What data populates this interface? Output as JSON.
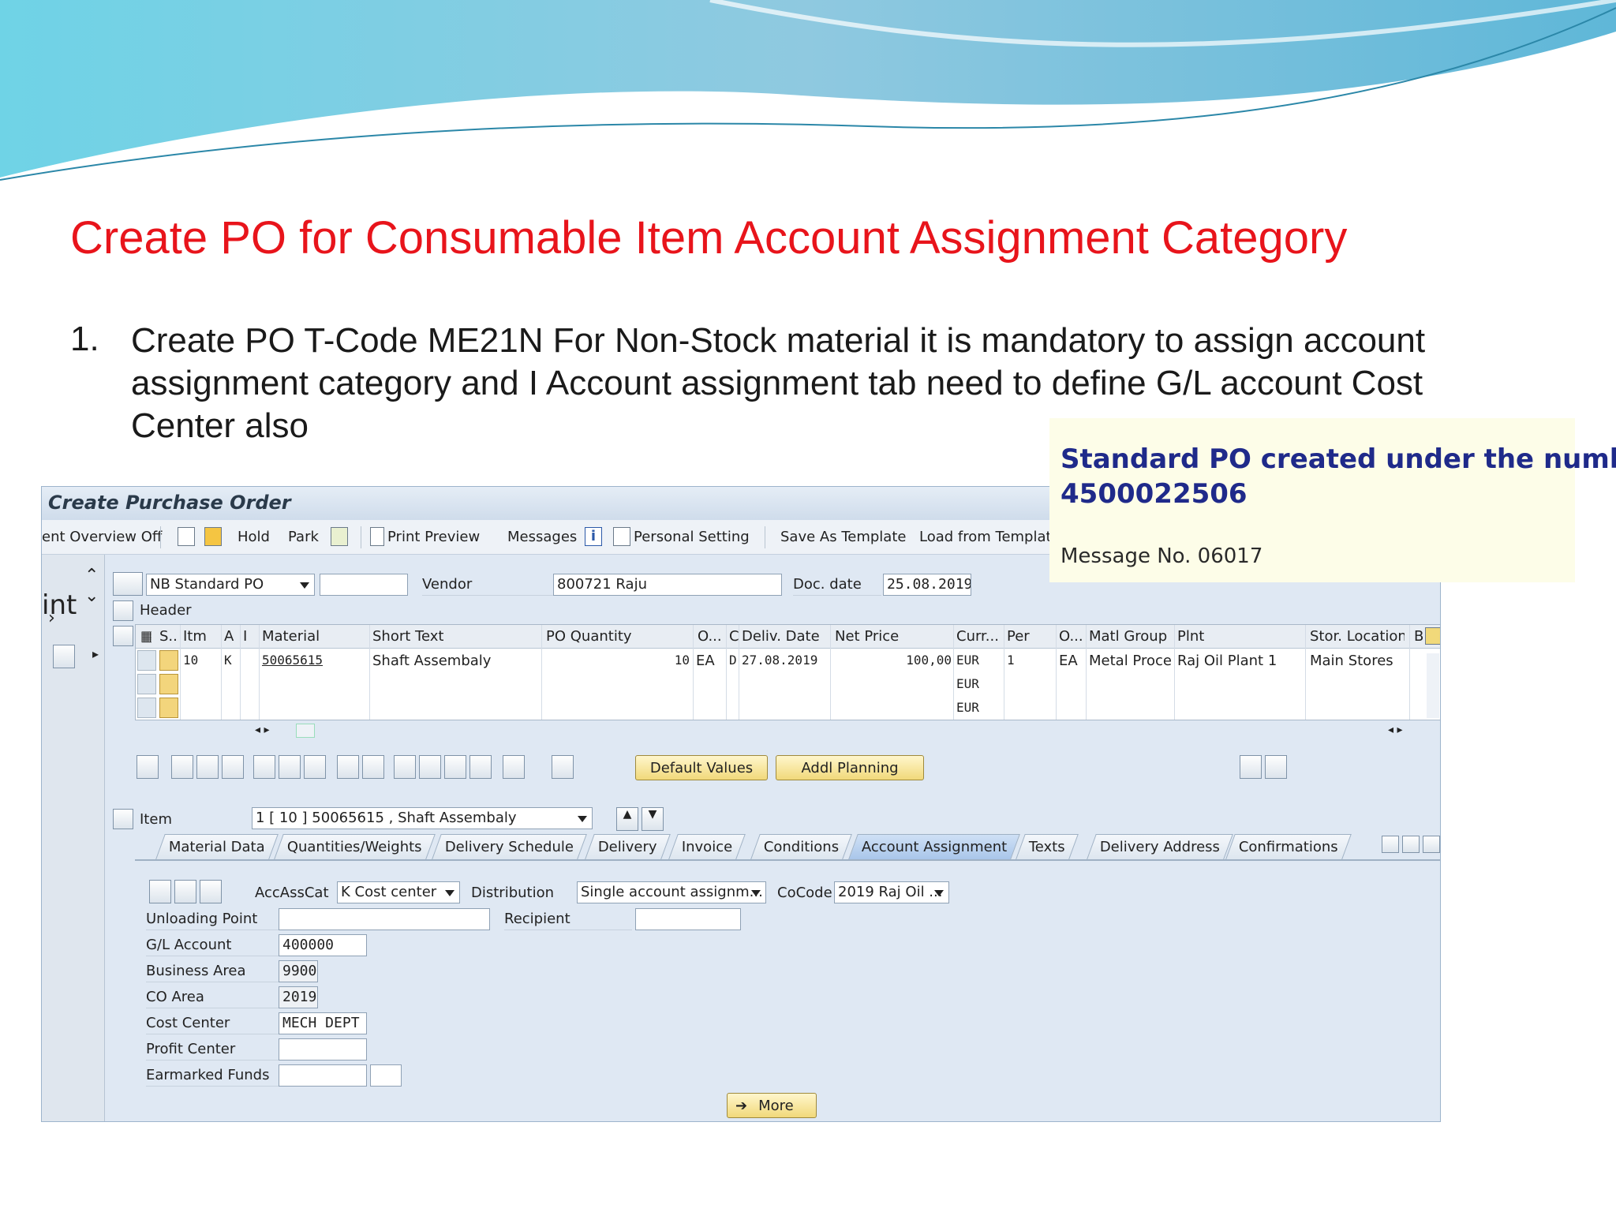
{
  "slide": {
    "title": "Create PO for Consumable Item Account Assignment Category",
    "bullet_number": "1.",
    "bullet_text": "Create PO T-Code ME21N For Non-Stock material it is mandatory to assign account assignment category and I  Account assignment tab  need to define G/L account Cost Center also"
  },
  "popup": {
    "message_line1": "Standard PO created under the number",
    "message_line2": "4500022506",
    "message_no": "Message No. 06017"
  },
  "window": {
    "title": "Create Purchase Order",
    "toolbar": {
      "document_overview": "ent Overview Off",
      "hold": "Hold",
      "park": "Park",
      "print_preview": "Print Preview",
      "messages": "Messages",
      "personal_setting": "Personal Setting",
      "save_as_template": "Save As Template",
      "load_from_template": "Load from Template"
    }
  },
  "header_row": {
    "po_type": "NB Standard PO",
    "vendor_label": "Vendor",
    "vendor_value": "800721 Raju",
    "doc_date_label": "Doc. date",
    "doc_date_value": "25.08.2019",
    "header_label": "Header",
    "nav_text": "int"
  },
  "items_table": {
    "columns": [
      "S..",
      "Itm",
      "A",
      "I",
      "Material",
      "Short Text",
      "PO Quantity",
      "O...",
      "C",
      "Deliv. Date",
      "Net Price",
      "Curr...",
      "Per",
      "O...",
      "Matl Group",
      "Plnt",
      "Stor. Location",
      "B"
    ],
    "rows": [
      {
        "itm": "10",
        "a": "K",
        "i": "",
        "material": "50065615",
        "short_text": "Shaft Assembaly",
        "qty": "10",
        "uom": "EA",
        "c": "D",
        "deliv_date": "27.08.2019",
        "net_price": "100,00",
        "curr": "EUR",
        "per": "1",
        "o2": "EA",
        "matl_group": "Metal Proce...",
        "plnt": "Raj Oil Plant 1",
        "stor_loc": "Main Stores"
      },
      {
        "itm": "",
        "a": "",
        "i": "",
        "material": "",
        "short_text": "",
        "qty": "",
        "uom": "",
        "c": "",
        "deliv_date": "",
        "net_price": "",
        "curr": "EUR",
        "per": "",
        "o2": "",
        "matl_group": "",
        "plnt": "",
        "stor_loc": ""
      },
      {
        "itm": "",
        "a": "",
        "i": "",
        "material": "",
        "short_text": "",
        "qty": "",
        "uom": "",
        "c": "",
        "deliv_date": "",
        "net_price": "",
        "curr": "EUR",
        "per": "",
        "o2": "",
        "matl_group": "",
        "plnt": "",
        "stor_loc": ""
      }
    ]
  },
  "buttons": {
    "default_values": "Default Values",
    "addl_planning": "Addl Planning",
    "more": "More"
  },
  "item_detail": {
    "item_label": "Item",
    "item_selector": "1 [ 10 ] 50065615 , Shaft Assembaly",
    "tabs": [
      "Material Data",
      "Quantities/Weights",
      "Delivery Schedule",
      "Delivery",
      "Invoice",
      "Conditions",
      "Account Assignment",
      "Texts",
      "Delivery Address",
      "Confirmations"
    ],
    "active_tab": "Account Assignment"
  },
  "account_assignment": {
    "accasscat_label": "AccAssCat",
    "accasscat_value": "K Cost center",
    "distribution_label": "Distribution",
    "distribution_value": "Single account assignm...",
    "cocode_label": "CoCode",
    "cocode_value": "2019 Raj Oil ...",
    "unloading_point_label": "Unloading Point",
    "unloading_point_value": "",
    "recipient_label": "Recipient",
    "recipient_value": "",
    "gl_account_label": "G/L Account",
    "gl_account_value": "400000",
    "business_area_label": "Business Area",
    "business_area_value": "9900",
    "co_area_label": "CO Area",
    "co_area_value": "2019",
    "cost_center_label": "Cost Center",
    "cost_center_value": "MECH DEPT",
    "profit_center_label": "Profit Center",
    "profit_center_value": "",
    "earmarked_funds_label": "Earmarked Funds",
    "earmarked_funds_value": ""
  },
  "colors": {
    "title_red": "#e8141b",
    "message_blue": "#1f2a8a",
    "sap_bg": "#dfe8f3",
    "button_yellow": "#f1d97a"
  }
}
